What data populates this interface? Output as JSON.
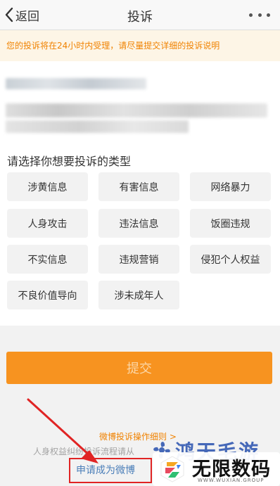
{
  "nav": {
    "back_label": "返回",
    "title": "投诉"
  },
  "notice": "您的投诉将在24小时内受理，请尽量提交详细的投诉说明",
  "section_title": "请选择你想要投诉的类型",
  "categories": [
    "涉黄信息",
    "有害信息",
    "网络暴力",
    "人身攻击",
    "违法信息",
    "饭圈违规",
    "不实信息",
    "违规营销",
    "侵犯个人权益",
    "不良价值导向",
    "涉未成年人"
  ],
  "submit_label": "提交",
  "footer": {
    "rules_link": "微博投诉操作细则 >",
    "hint_text": "人身权益纠纷投诉流程请从",
    "apply_link": "申请成为微博"
  },
  "watermark": {
    "top_text": "鸿天毛游",
    "title": "无限数码",
    "subtitle": "WWW.WUXIAN.GROUP"
  },
  "colors": {
    "accent": "#f79320",
    "notice_text": "#f08200",
    "link_blue": "#4a7eb8",
    "highlight_red": "#e02424"
  }
}
